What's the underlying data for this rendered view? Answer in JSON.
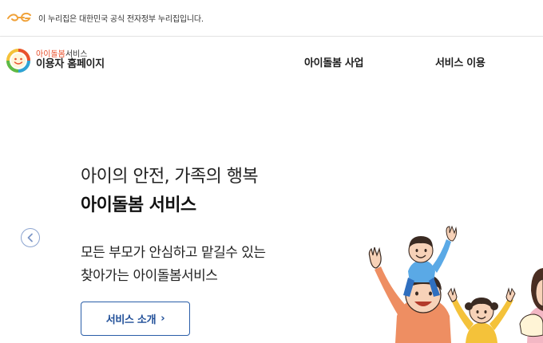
{
  "gov_banner": {
    "text": "이 누리집은 대한민국 공식 전자정부 누리집입니다."
  },
  "header": {
    "brand_accent": "아이돌봄",
    "brand_suffix": "서비스",
    "brand_subtitle": "이용자 홈페이지",
    "nav": [
      {
        "label": "아이돌봄 사업"
      },
      {
        "label": "서비스 이용"
      }
    ]
  },
  "hero": {
    "tagline": "아이의 안전, 가족의 행복",
    "title": "아이돌봄 서비스",
    "description_line1": "모든 부모가 안심하고 맡길수 있는",
    "description_line2": "찾아가는 아이돌봄서비스",
    "button_label": "서비스 소개",
    "button_chevron": "›"
  },
  "colors": {
    "accent_orange": "#e8512e",
    "button_blue": "#1f4e98",
    "arrow_blue": "#8ca4d0"
  },
  "icons": [
    "eg-logo-icon",
    "smiley-logo-icon",
    "chevron-left-icon",
    "chevron-right-icon"
  ]
}
